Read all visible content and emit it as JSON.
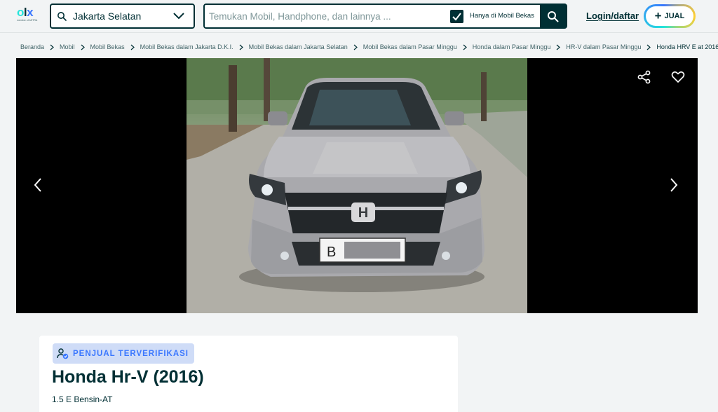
{
  "header": {
    "logo": {
      "text": "OLX",
      "tagline": "member of ASTRA"
    },
    "location": {
      "value": "Jakarta Selatan"
    },
    "search": {
      "placeholder": "Temukan Mobil, Handphone, dan lainnya ...",
      "value": ""
    },
    "only_used_cars": {
      "label": "Hanya di Mobil Bekas",
      "checked": true
    },
    "login_label": "Login/daftar",
    "sell_label": "JUAL"
  },
  "breadcrumb": [
    "Beranda",
    "Mobil",
    "Mobil Bekas",
    "Mobil Bekas dalam Jakarta D.K.I.",
    "Mobil Bekas dalam Jakarta Selatan",
    "Mobil Bekas dalam Pasar Minggu",
    "Honda dalam Pasar Minggu",
    "HR-V dalam Pasar Minggu",
    "Honda HRV E at 2016"
  ],
  "gallery": {
    "photo_subject": "Silver Honda HR-V front view",
    "plate_visible_text": "B",
    "icons": [
      "chevron-left-icon",
      "chevron-right-icon",
      "share-icon",
      "heart-icon"
    ]
  },
  "listing": {
    "badge": "PENJUAL TERVERIFIKASI",
    "title": "Honda Hr-V (2016)",
    "subtitle": "1.5 E Bensin-AT"
  },
  "colors": {
    "primary": "#002f34",
    "badge_bg": "#cfdcf7",
    "badge_text": "#3a77ff",
    "page_bg": "#f2f4f5"
  }
}
